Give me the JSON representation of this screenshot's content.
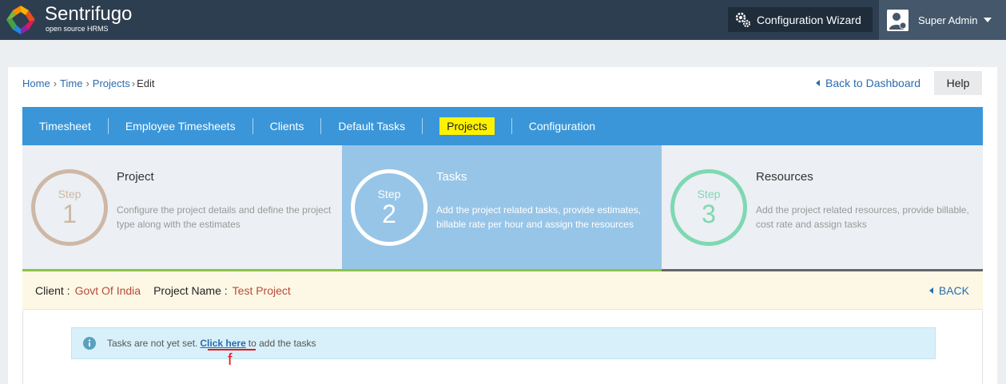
{
  "topbar": {
    "brand": "Sentrifugo",
    "brand_sub": "open source HRMS",
    "wizard_label": "Configuration Wizard",
    "user_label": "Super Admin"
  },
  "breadcrumb": {
    "home": "Home",
    "time": "Time",
    "projects": "Projects",
    "current": "Edit"
  },
  "header": {
    "back_dashboard": "Back to Dashboard",
    "help": "Help"
  },
  "tabs": [
    "Timesheet",
    "Employee Timesheets",
    "Clients",
    "Default Tasks",
    "Projects",
    "Configuration"
  ],
  "steps": [
    {
      "word": "Step",
      "num": "1",
      "title": "Project",
      "desc": "Configure the project details and define the project type along with the estimates"
    },
    {
      "word": "Step",
      "num": "2",
      "title": "Tasks",
      "desc": "Add the project related tasks, provide estimates, billable rate per hour and assign the resources"
    },
    {
      "word": "Step",
      "num": "3",
      "title": "Resources",
      "desc": "Add the project related resources, provide billable, cost rate and assign tasks"
    }
  ],
  "info": {
    "client_label": "Client :",
    "client_value": "Govt Of India",
    "project_label": "Project Name :",
    "project_value": "Test Project",
    "back": "BACK"
  },
  "alert": {
    "pre": "Tasks are not yet set.",
    "link": "Click here",
    "post": "to add the tasks"
  },
  "annotation": "f",
  "colors": {
    "topbar": "#2d3e50",
    "nav": "#3a96d8",
    "active_tab": "#fff200",
    "link": "#2a6cb0",
    "annotation": "#e11111"
  }
}
